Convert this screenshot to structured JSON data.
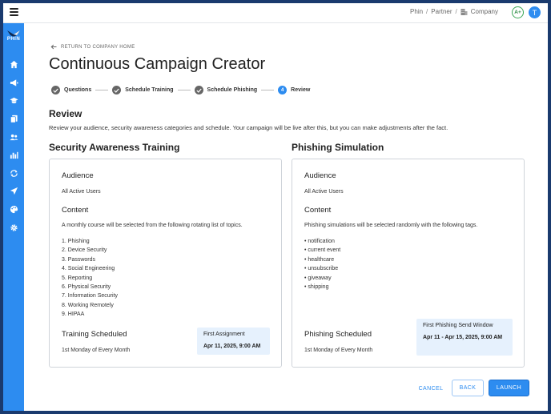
{
  "topbar": {
    "breadcrumb": [
      "Phin",
      "Partner",
      "Company"
    ],
    "sep": "/",
    "grade": "A+",
    "avatar_initial": "T"
  },
  "sidebar": {
    "logo_text": "PHIN",
    "items": [
      "home-icon",
      "megaphone-icon",
      "graduation-cap-icon",
      "documents-icon",
      "users-icon",
      "bar-chart-icon",
      "sync-icon",
      "send-icon",
      "palette-icon",
      "gear-icon"
    ]
  },
  "main": {
    "back_label": "RETURN TO COMPANY HOME",
    "title": "Continuous Campaign Creator",
    "steps": [
      {
        "label": "Questions",
        "state": "done"
      },
      {
        "label": "Schedule Training",
        "state": "done"
      },
      {
        "label": "Schedule Phishing",
        "state": "done"
      },
      {
        "label": "Review",
        "state": "active",
        "number": "4"
      }
    ],
    "review_heading": "Review",
    "review_desc": "Review your audience, security awareness categories and schedule. Your campaign will be live after this, but you can make adjustments after the fact."
  },
  "training": {
    "title": "Security Awareness Training",
    "audience_h": "Audience",
    "audience": "All Active Users",
    "content_h": "Content",
    "content_desc": "A monthly course will be selected from the following rotating list of topics.",
    "topics": [
      "1. Phishing",
      "2. Device Security",
      "3. Passwords",
      "4. Social Engineering",
      "5. Reporting",
      "6. Physical Security",
      "7. Information Security",
      "8. Working Remotely",
      "9. HIPAA"
    ],
    "scheduled_h": "Training Scheduled",
    "scheduled": "1st Monday of Every Month",
    "first_label": "First Assignment",
    "first_value": "Apr 11, 2025, 9:00 AM"
  },
  "phishing": {
    "title": "Phishing Simulation",
    "audience_h": "Audience",
    "audience": "All Active Users",
    "content_h": "Content",
    "content_desc": "Phishing simulations will be selected randomly with the following tags.",
    "tags": [
      "• notification",
      "• current event",
      "• healthcare",
      "• unsubscribe",
      "• giveaway",
      "• shipping"
    ],
    "scheduled_h": "Phishing Scheduled",
    "scheduled": "1st Monday of Every Month",
    "first_label": "First Phishing Send Window",
    "first_value": "Apr 11 - Apr 15, 2025, 9:00 AM"
  },
  "footer": {
    "cancel": "CANCEL",
    "back": "BACK",
    "launch": "LAUNCH"
  },
  "colors": {
    "accent": "#2d8cf0",
    "frame": "#1a3a6e",
    "grade": "#3aa655"
  }
}
